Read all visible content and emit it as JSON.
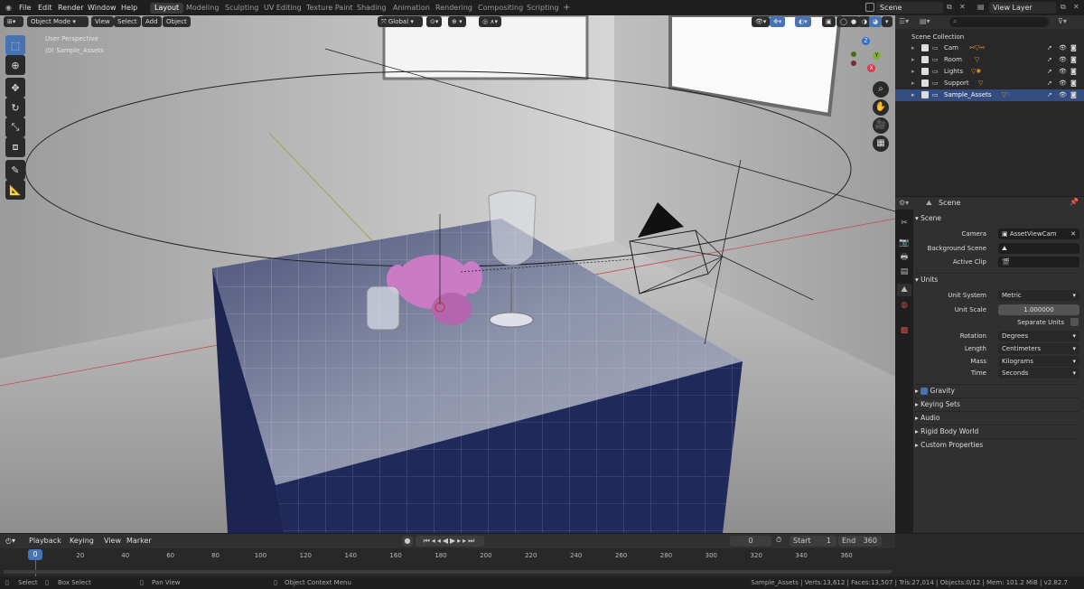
{
  "topbar": {
    "menus": [
      "File",
      "Edit",
      "Render",
      "Window",
      "Help"
    ],
    "workspaces": [
      "Layout",
      "Modeling",
      "Sculpting",
      "UV Editing",
      "Texture Paint",
      "Shading",
      "Animation",
      "Rendering",
      "Compositing",
      "Scripting"
    ],
    "add_tab": "+",
    "scene_value": "Scene",
    "view_layer_value": "View Layer"
  },
  "viewport": {
    "mode": "Object Mode",
    "menus": [
      "View",
      "Select",
      "Add",
      "Object"
    ],
    "orientation": "Global",
    "overlay_line1": "User Perspective",
    "overlay_line2": "(0) Sample_Assets",
    "gizmo_axes": {
      "x": "X",
      "y": "Y",
      "z": "Z"
    }
  },
  "outliner": {
    "collection": "Scene Collection",
    "items": [
      {
        "name": "Cam",
        "selected": false
      },
      {
        "name": "Room",
        "selected": false
      },
      {
        "name": "Lights",
        "selected": false
      },
      {
        "name": "Support",
        "selected": false
      },
      {
        "name": "Sample_Assets",
        "selected": true
      }
    ]
  },
  "properties": {
    "header": "Scene",
    "scene_section": "Scene",
    "camera_label": "Camera",
    "camera_value": "AssetViewCam",
    "background_label": "Background Scene",
    "clip_label": "Active Clip",
    "units_section": "Units",
    "unit_system_label": "Unit System",
    "unit_system_value": "Metric",
    "unit_scale_label": "Unit Scale",
    "unit_scale_value": "1.000000",
    "separate_units_label": "Separate Units",
    "rotation_label": "Rotation",
    "rotation_value": "Degrees",
    "length_label": "Length",
    "length_value": "Centimeters",
    "mass_label": "Mass",
    "mass_value": "Kilograms",
    "time_label": "Time",
    "time_value": "Seconds",
    "gravity_label": "Gravity",
    "keying_sets": "Keying Sets",
    "audio": "Audio",
    "rigid_body": "Rigid Body World",
    "custom_props": "Custom Properties"
  },
  "timeline": {
    "menus": [
      "Playback",
      "Keying",
      "View",
      "Marker"
    ],
    "current_frame": "0",
    "start_label": "Start",
    "start_value": "1",
    "end_label": "End",
    "end_value": "360",
    "playhead": "0",
    "ticks": [
      "20",
      "40",
      "60",
      "80",
      "100",
      "120",
      "140",
      "160",
      "180",
      "200",
      "220",
      "240",
      "260",
      "280",
      "300",
      "320",
      "340",
      "360"
    ]
  },
  "status": {
    "select": "Select",
    "box_select": "Box Select",
    "pan_view": "Pan View",
    "context_menu": "Object Context Menu",
    "stats": "Sample_Assets | Verts:13,612 | Faces:13,507 | Tris:27,014 | Objects:0/12 | Mem: 101.2 MiB | v2.82.7"
  },
  "colors": {
    "accent": "#4772b3",
    "selected_row": "#334d80",
    "cube": "#1f2a5a",
    "monkey": "#c97bc4"
  }
}
